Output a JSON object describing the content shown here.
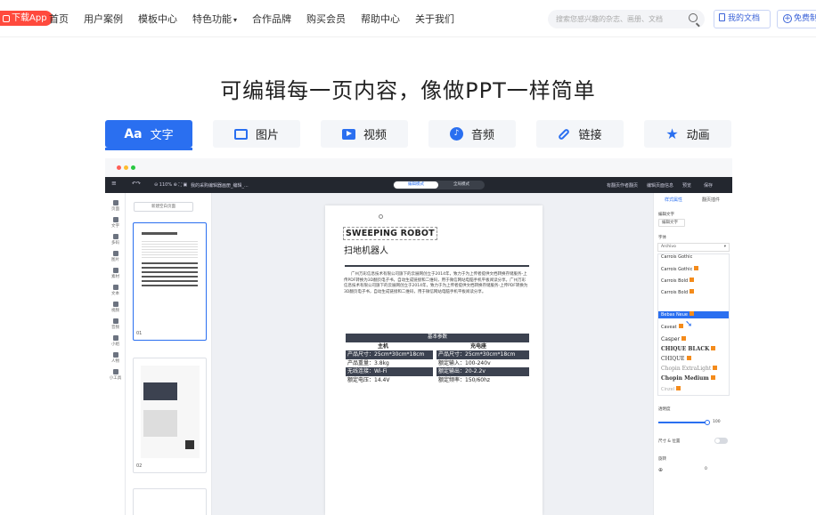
{
  "topnav": {
    "download_app": "下载App",
    "items": [
      "首页",
      "用户案例",
      "模板中心",
      "特色功能",
      "合作品牌",
      "购买会员",
      "帮助中心",
      "关于我们"
    ],
    "search_placeholder": "搜索您感兴趣的杂志、画册、文档",
    "my_docs": "我的文档",
    "free": "免费制作"
  },
  "headline": "可编辑每一页内容，像做PPT一样简单",
  "feature_tabs": [
    {
      "label": "文字",
      "icon": "Aa"
    },
    {
      "label": "图片",
      "icon": "image-icon"
    },
    {
      "label": "视频",
      "icon": "video-icon"
    },
    {
      "label": "音频",
      "icon": "audio-icon"
    },
    {
      "label": "链接",
      "icon": "link-icon"
    },
    {
      "label": "动画",
      "icon": "star-icon"
    }
  ],
  "editor": {
    "doc_title": "我的采购编辑器画册_编辑_...",
    "zoom": "110%",
    "mode_edit": "编辑模式",
    "mode_all": "全局模式",
    "right_labels": [
      "有翻页作者翻页",
      "编辑页面信息",
      "预览",
      "保存"
    ],
    "left_bar": [
      "页面",
      "文字",
      "多码",
      "图片",
      "素材",
      "文本",
      "视频",
      "音频",
      "小组",
      "人物",
      "小工具"
    ],
    "new_page": "新建空白页面",
    "thumb_nums": [
      "01",
      "02"
    ],
    "right_tabs": [
      "样式属性",
      "翻页插件"
    ],
    "text_section": "编辑文字",
    "text_style": "编辑文字",
    "font_section": "字体",
    "font_current": "Archivo",
    "fonts": [
      "Carrois Gothic",
      "Carrois Gothic",
      "Carrois Bold",
      "Carrois Bold",
      "Casual",
      "Bebas Neue",
      "Caveat",
      "Casper",
      "CHIQUE BLACK",
      "CHIQUE",
      "Chopin ExtraLight",
      "Chopin Medium",
      "Cinzel"
    ],
    "opacity_label": "透明度",
    "opacity_value": "100",
    "size_label": "尺寸 & 位置",
    "rotate_label": "旋转",
    "rotate_value": "0"
  },
  "page": {
    "title_en": "SWEEPING ROBOT",
    "title_cn": "扫地机器人",
    "body": "广州万彩信息技术有限公司旗下的云展网创立于2014年，致力于为上传者提供文档转换存储服务-上传PDF转换为3D翻页电子书，自动生成链接和二维码，用于微信网站电脑手机平板阅读分享。广州万彩信息技术有限公司旗下的云展网创立于2014年，致力于为上传者提供文档转换存储服务-上传PDF转换为3D翻页电子书，自动生成链接和二维码，用于微信网站电脑手机平板阅读分享。",
    "spec_title": "基本参数",
    "col_main": "主机",
    "col_dock": "充电座",
    "rows": [
      [
        "产品尺寸：25cm*30cm*18cm",
        "产品尺寸：25cm*30cm*18cm"
      ],
      [
        "产品重量：3.8kg",
        "额定输入：100-240v"
      ],
      [
        "无线连接：Wi-Fi",
        "额定输出：20-2.2v"
      ],
      [
        "额定电压：14.4V",
        "额定频率：150/60hz"
      ]
    ]
  },
  "colors": {
    "accent": "#2a6ff0",
    "dl_app": "#ff4a3d"
  }
}
